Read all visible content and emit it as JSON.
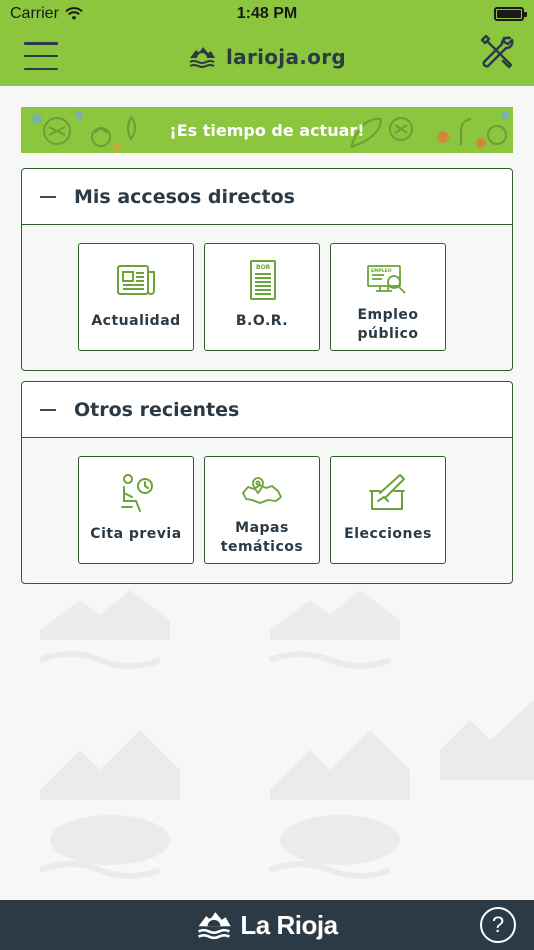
{
  "status_bar": {
    "carrier": "Carrier",
    "time": "1:48 PM"
  },
  "header": {
    "title": "larioja.org"
  },
  "banner": {
    "text": "¡Es tiempo de actuar!"
  },
  "sections": [
    {
      "title": "Mis accesos directos",
      "tiles": [
        {
          "label": "Actualidad",
          "icon": "newspaper-icon"
        },
        {
          "label": "B.O.R.",
          "icon": "bor-document-icon",
          "icon_text": "BOR"
        },
        {
          "label_line1": "Empleo",
          "label_line2": "público",
          "icon": "employment-computer-icon",
          "icon_text": "EMPLEO"
        }
      ]
    },
    {
      "title": "Otros recientes",
      "tiles": [
        {
          "label": "Cita previa",
          "icon": "appointment-icon"
        },
        {
          "label_line1": "Mapas",
          "label_line2": "temáticos",
          "icon": "map-icon"
        },
        {
          "label": "Elecciones",
          "icon": "ballot-icon"
        }
      ]
    }
  ],
  "footer": {
    "brand": "La Rioja",
    "help_symbol": "?"
  },
  "colors": {
    "brand_green": "#8cc63f",
    "dark": "#2b3a45",
    "border_green": "#2f5f2a"
  }
}
